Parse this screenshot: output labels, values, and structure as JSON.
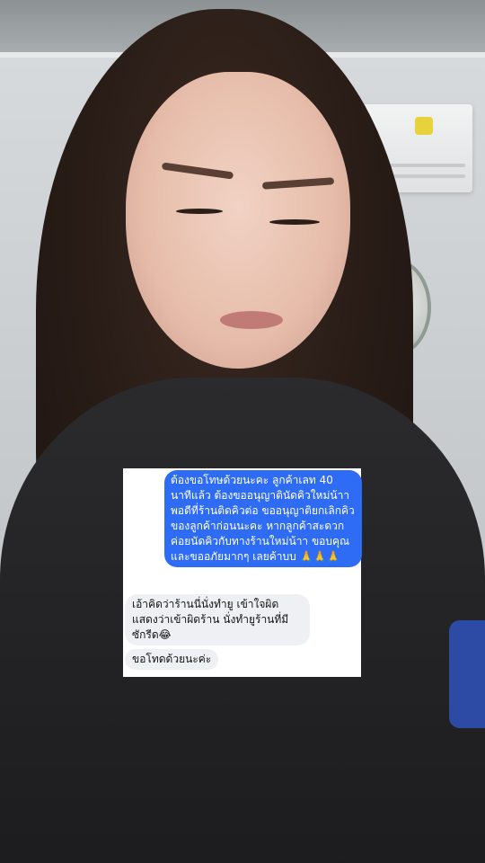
{
  "chat": {
    "outgoing": "ต้องขอโทษด้วยนะคะ ลูกค้าเลท 40 นาทีแล้ว ต้องขออนุญาตินัดคิวใหม่น้าา พอดีที่ร้านติดคิวต่อ ขออนุญาติยกเลิกคิวของลูกค้าก่อนนะคะ หากลูกค้าสะดวกค่อยนัดคิวกับทางร้านใหม่น้าา ขอบคุณและขออภัยมากๆ เลยค้าบบ 🙏🙏🙏",
    "incoming_1": "เอ้าคิดว่าร้านนี่นั่งทำยู เข้าใจผิด แสดงว่าเข้าผิดร้าน นั่งทำยูร้านที่มีซักรีด😂",
    "incoming_2": "ขอโทดด้วยนะค่ะ"
  },
  "colors": {
    "outgoing_bubble": "#2f6cf5",
    "incoming_bubble": "#eef0f3"
  }
}
